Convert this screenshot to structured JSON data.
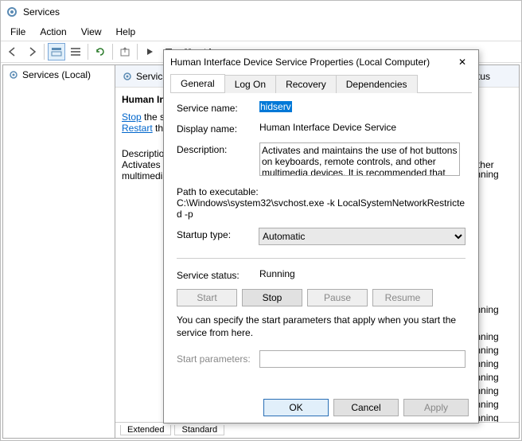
{
  "window": {
    "title": "Services",
    "menus": [
      "File",
      "Action",
      "View",
      "Help"
    ],
    "tree_item": "Services (Local)",
    "detail_header": "Services",
    "selected_service": "Human Interface Device Service",
    "actions": {
      "stop": "Stop",
      "restart": "Restart",
      "suffix": " the service"
    },
    "desc_label": "Description:",
    "desc_body": "Activates and maintains the use of hot buttons on keyboards, remote controls, and other multimedia devices. It is recommended that you keep this service running.",
    "status_header": "Status",
    "status_running": "Running"
  },
  "dialog": {
    "title": "Human Interface Device Service Properties (Local Computer)",
    "tabs": [
      "General",
      "Log On",
      "Recovery",
      "Dependencies"
    ],
    "labels": {
      "service_name": "Service name:",
      "display_name": "Display name:",
      "description": "Description:",
      "path_label": "Path to executable:",
      "startup_type": "Startup type:",
      "service_status": "Service status:",
      "start_params": "Start parameters:"
    },
    "values": {
      "service_name": "hidserv",
      "display_name": "Human Interface Device Service",
      "description": "Activates and maintains the use of hot buttons on keyboards, remote controls, and other multimedia devices. It is recommended that you keep this",
      "path": "C:\\Windows\\system32\\svchost.exe -k LocalSystemNetworkRestricted -p",
      "startup_type": "Automatic",
      "status": "Running"
    },
    "buttons": {
      "start": "Start",
      "stop": "Stop",
      "pause": "Pause",
      "resume": "Resume"
    },
    "note": "You can specify the start parameters that apply when you start the service from here.",
    "bottom": {
      "ok": "OK",
      "cancel": "Cancel",
      "apply": "Apply"
    }
  }
}
